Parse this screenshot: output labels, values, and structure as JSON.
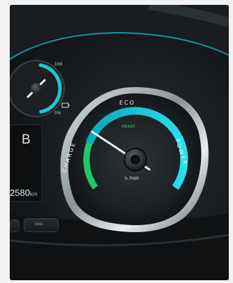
{
  "secondary_gauge": {
    "max_label": "100",
    "min_label": "0%",
    "icon": "battery-plug-icon",
    "fill_fraction": 0.55
  },
  "main_gauge": {
    "labels": {
      "left": "CHARGE",
      "top": "ECO",
      "right": "POWER"
    },
    "status": "READY",
    "unit": "% PWR",
    "needle_position": "charge-zone"
  },
  "display": {
    "gear": "B",
    "odometer": "2580",
    "odometer_unit": "km"
  },
  "controls": {
    "button_label": "ooo"
  },
  "colors": {
    "accent_cyan": "#16c9d9",
    "charge_green": "#22c76a",
    "ready_green": "#3fe05a",
    "dash_dark": "#16191b"
  }
}
